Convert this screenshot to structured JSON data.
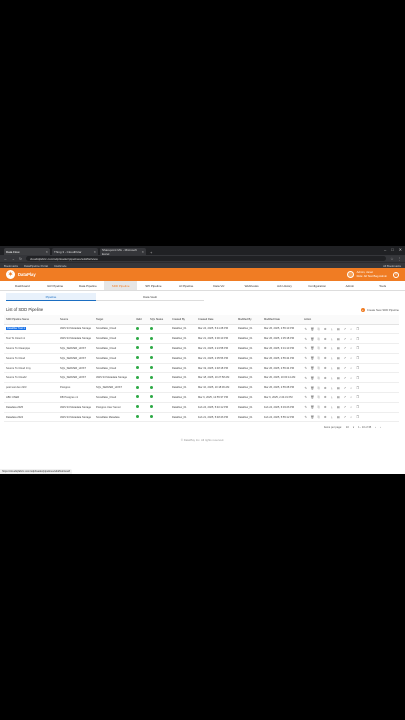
{
  "browser": {
    "tabs": [
      {
        "label": "Data Flow",
        "active": true
      },
      {
        "label": "Thing 3 - CloudPolar",
        "active": false
      },
      {
        "label": "Sharepoint Mix - Microsoft Excel",
        "active": false
      }
    ],
    "url": "cloudiqfabric.com/sdp/loader/pipelines/sdd/list/view",
    "bookmarks": [
      "Bookmarks",
      "DataPipeline Portal",
      "Intellicode"
    ],
    "bookmarks_right": "All Bookmarks"
  },
  "app": {
    "brand": "DataPlay",
    "user_name": "Admin, Janet",
    "user_sub": "Role: All  Test Bag  Admin"
  },
  "nav": {
    "items": [
      "Dashboard",
      "ILR Pipeline",
      "Data Pipeline",
      "SDD Pipeline",
      "SPI Pipeline",
      "AI Pipeline",
      "Data Viz",
      "Webhooks",
      "Job History",
      "Configuration",
      "Admin",
      "Tools"
    ],
    "active_index": 3
  },
  "subtabs": {
    "active": "Pipeline",
    "other": "Data Vault"
  },
  "list": {
    "title": "List of SDD Pipeline",
    "create_label": "Create New SDD Pipeline",
    "columns": [
      "SDD Pipeline Name",
      "Source",
      "Target",
      "Valid",
      "SQL Status",
      "Created By",
      "Created Date",
      "Modified By",
      "Modified Date",
      "Action"
    ],
    "rows": [
      [
        "Datafilter Test 1",
        "AWS S3 Metadata Storage",
        "Snowflake_Cloud",
        "Dataflow_01",
        "Mar 24, 2025, 5:41:28 PM",
        "Dataflow_01",
        "Mar 26, 2025, 2:55:10 PM"
      ],
      [
        "Test To Cloud v1",
        "AWS S3 Metadata Storage",
        "Snowflake_Cloud",
        "Dataflow_01",
        "Mar 21, 2025, 3:00:10 PM",
        "Dataflow_01",
        "Mar 26, 2025, 1:35:18 PM"
      ],
      [
        "Source To Cleanpipe",
        "SQL_SERVER_HOST",
        "Snowflake_Cloud",
        "Dataflow_01",
        "Mar 21, 2025, 2:24:58 PM",
        "Dataflow_01",
        "Mar 26, 2025, 3:01:10 PM"
      ],
      [
        "Source To Cloud",
        "SQL_SERVER_HOST",
        "Snowflake_Cloud",
        "Dataflow_01",
        "Mar 21, 2025, 2:05:56 PM",
        "Dataflow_01",
        "Mar 26, 2025, 2:55:44 PM"
      ],
      [
        "Source To Cloud Jrny",
        "SQL_SERVER_HOST",
        "Snowflake_Cloud",
        "Dataflow_01",
        "Mar 19, 2025, 2:48:18 PM",
        "Dataflow_01",
        "Mar 26, 2025, 2:55:44 PM"
      ],
      [
        "Source To Cloud2",
        "SQL_SERVER_HOST",
        "AWS S3 Metadata Storage",
        "Dataflow_01",
        "Mar 18, 2025, 10:27:58 AM",
        "Dataflow_01",
        "Mar 20, 2025, 10:00:14 AM"
      ],
      [
        "post test dev 22/3",
        "Postgres",
        "SQL_SERVER_HOST",
        "Dataflow_01",
        "Mar 10, 2025, 10:18:06 AM",
        "Dataflow_01",
        "Mar 26, 2025, 2:55:28 PM"
      ],
      [
        "ABC USER",
        "DB Postgres v1",
        "Snowflake_Cloud",
        "Dataflow_01",
        "Mar 6, 2025, 12:55:37 PM",
        "Dataflow_01",
        "Mar 6, 2025, 2:24:31 PM"
      ],
      [
        "Datadata 2025",
        "AWS S3 Metadata Storage",
        "Postgres User Server",
        "Dataflow_01",
        "Feb 24, 2025, 5:40:12 PM",
        "Dataflow_01",
        "Feb 24, 2025, 6:03:26 PM"
      ],
      [
        "Datadata 2024",
        "AWS S3 Metadata Storage",
        "Snowflake Metadata",
        "Dataflow_01",
        "Feb 21, 2025, 5:48:46 PM",
        "Dataflow_01",
        "Feb 24, 2025, 5:55:12 PM"
      ]
    ],
    "selected_row": 0
  },
  "pager": {
    "label": "Items per page:",
    "size": "10",
    "range": "1 - 10 of 35"
  },
  "footer": "© DataPlay Inc. All rights reserved.",
  "status_url": "https://cloudiqfabric.com/sdp/loader/pipelines/sdd/list/view#"
}
